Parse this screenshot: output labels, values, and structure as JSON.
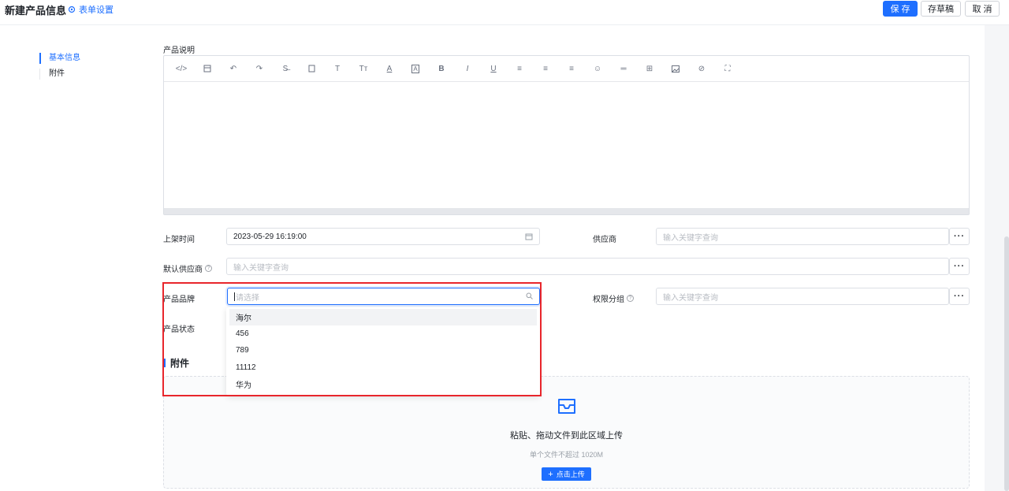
{
  "header": {
    "title": "新建产品信息",
    "form_settings": "表单设置",
    "save": "保 存",
    "draft": "存草稿",
    "cancel": "取 消"
  },
  "sidebar": {
    "items": [
      {
        "label": "基本信息",
        "active": true
      },
      {
        "label": "附件",
        "active": false
      }
    ]
  },
  "form": {
    "description_label": "产品说明",
    "listing_time_label": "上架时间",
    "listing_time_value": "2023-05-29 16:19:00",
    "supplier_label": "供应商",
    "supplier_placeholder": "输入关键字查询",
    "default_supplier_label": "默认供应商",
    "default_supplier_placeholder": "输入关键字查询",
    "brand_label": "产品品牌",
    "brand_placeholder": "请选择",
    "permission_group_label": "权限分组",
    "permission_group_placeholder": "输入关键字查询",
    "status_label": "产品状态",
    "dots": "···"
  },
  "brand_options": [
    "海尔",
    "456",
    "789",
    "11112",
    "华为"
  ],
  "attachments": {
    "section_title": "附件",
    "upload_title": "粘贴、拖动文件到此区域上传",
    "upload_hint": "单个文件不超过 1020M",
    "upload_button": "点击上传"
  },
  "colors": {
    "accent": "#1e6fff",
    "highlight": "#e8262c"
  }
}
